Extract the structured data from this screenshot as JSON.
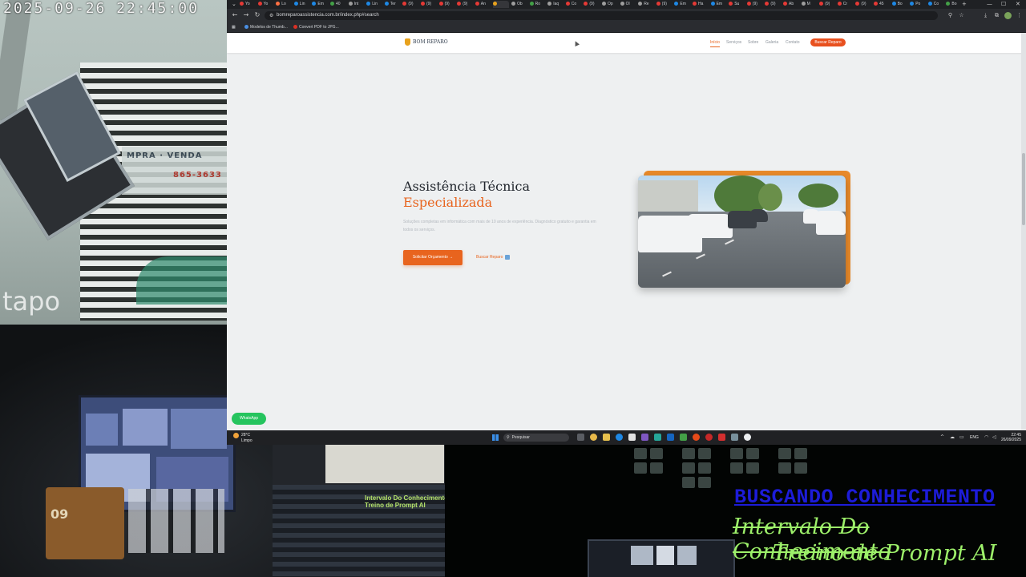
{
  "camera": {
    "timestamp": "2025-09-26  22:45:00",
    "brand": "tapo",
    "sign_line1": "MPRA · VENDA",
    "sign_line2": "865-3633"
  },
  "desk": {
    "calendar_day": "09",
    "monitor_text": "Intervalo Do Conhecimento\nTreino de Prompt AI"
  },
  "overlay": {
    "title": "BUSCANDO CONHECIMENTO",
    "strike": "Intervalo Do Conhecimento",
    "subtitle": "Treino de Prompt AI"
  },
  "browser": {
    "tabs": [
      {
        "label": "Yo",
        "color": "#e53935"
      },
      {
        "label": "Yo",
        "color": "#e53935"
      },
      {
        "label": "Lo",
        "color": "#ff7043"
      },
      {
        "label": "Lin",
        "color": "#1e88e5"
      },
      {
        "label": "Em",
        "color": "#1e88e5"
      },
      {
        "label": "40",
        "color": "#43a047"
      },
      {
        "label": "Int",
        "color": "#9e9e9e"
      },
      {
        "label": "Lin",
        "color": "#1e88e5"
      },
      {
        "label": "Ter",
        "color": "#1e88e5"
      },
      {
        "label": "(9)",
        "color": "#e53935"
      },
      {
        "label": "(9)",
        "color": "#e53935"
      },
      {
        "label": "(9)",
        "color": "#e53935"
      },
      {
        "label": "(9)",
        "color": "#e53935"
      },
      {
        "label": "An",
        "color": "#e53935"
      },
      {
        "label": "",
        "color": "#e8a21d",
        "active": true
      },
      {
        "label": "Ob",
        "color": "#9e9e9e"
      },
      {
        "label": "Ro",
        "color": "#43a047"
      },
      {
        "label": "Iaq",
        "color": "#9e9e9e"
      },
      {
        "label": "Co",
        "color": "#e53935"
      },
      {
        "label": "(9)",
        "color": "#e53935"
      },
      {
        "label": "Op",
        "color": "#9e9e9e"
      },
      {
        "label": "Ol",
        "color": "#9e9e9e"
      },
      {
        "label": "Re",
        "color": "#9e9e9e"
      },
      {
        "label": "(9)",
        "color": "#e53935"
      },
      {
        "label": "Em",
        "color": "#1e88e5"
      },
      {
        "label": "Ha",
        "color": "#e53935"
      },
      {
        "label": "Em",
        "color": "#1e88e5"
      },
      {
        "label": "Su",
        "color": "#e53935"
      },
      {
        "label": "(9)",
        "color": "#e53935"
      },
      {
        "label": "(9)",
        "color": "#e53935"
      },
      {
        "label": "Ab",
        "color": "#e53935"
      },
      {
        "label": "M",
        "color": "#9e9e9e"
      },
      {
        "label": "(9)",
        "color": "#e53935"
      },
      {
        "label": "Cr",
        "color": "#e53935"
      },
      {
        "label": "(9)",
        "color": "#e53935"
      },
      {
        "label": "45",
        "color": "#e53935"
      },
      {
        "label": "Bo",
        "color": "#1e88e5"
      },
      {
        "label": "Po",
        "color": "#1e88e5"
      },
      {
        "label": "Co",
        "color": "#1e88e5"
      },
      {
        "label": "Bo",
        "color": "#43a047"
      }
    ],
    "url": "bomreparoassistencia.com.br/index.php#search",
    "bookmarks": [
      "Modelos de Thumb...",
      "Convert PDF to JPG..."
    ]
  },
  "site": {
    "logo": "BOM REPARO",
    "nav": [
      "Início",
      "Serviços",
      "Sobre",
      "Galeria",
      "Contato"
    ],
    "nav_cta": "Buscar Reparo",
    "hero_title_line1": "Assistência Técnica",
    "hero_title_line2": "Especializada",
    "hero_description": "Soluções completas em informática com mais de 10 anos de experiência. Diagnóstico gratuito e garantia em todos os serviços.",
    "primary_button": "Solicitar Orçamento →",
    "secondary_button": "Buscar Reparo",
    "whatsapp": "WhatsApp"
  },
  "taskbar": {
    "temperature": "28°C",
    "weather": "Limpo",
    "search_placeholder": "Pesquisar",
    "language": "ENG",
    "time": "22:45",
    "date": "26/09/2025"
  }
}
